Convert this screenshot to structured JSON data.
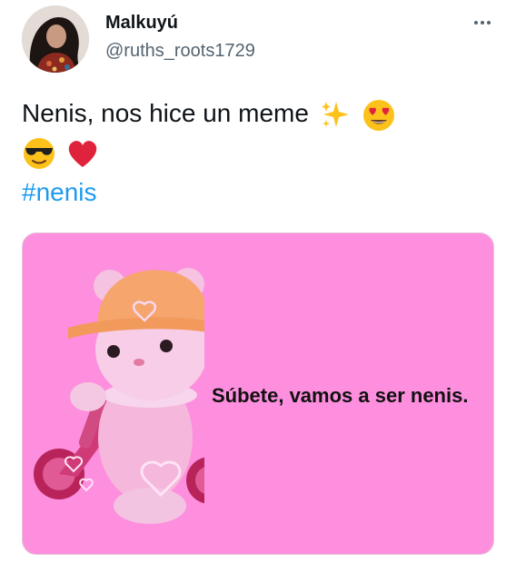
{
  "tweet": {
    "author": {
      "display_name": "Malkuyú",
      "handle": "@ruths_roots1729",
      "avatar_icon": "profile-photo"
    },
    "more_icon": "more-horizontal-icon",
    "text": "Nenis, nos hice un meme",
    "emojis_line1": [
      "sparkles-emoji",
      "heart-eyes-emoji"
    ],
    "emojis_line2": [
      "sunglasses-emoji",
      "red-heart-emoji"
    ],
    "hashtag": "#nenis",
    "media": {
      "caption": "Súbete, vamos a ser nenis.",
      "background_color": "#fe8ede",
      "illustration": "pink toy bear on a tricycle"
    }
  },
  "colors": {
    "text_primary": "#0f1419",
    "text_secondary": "#536471",
    "link": "#1d9bf0"
  }
}
